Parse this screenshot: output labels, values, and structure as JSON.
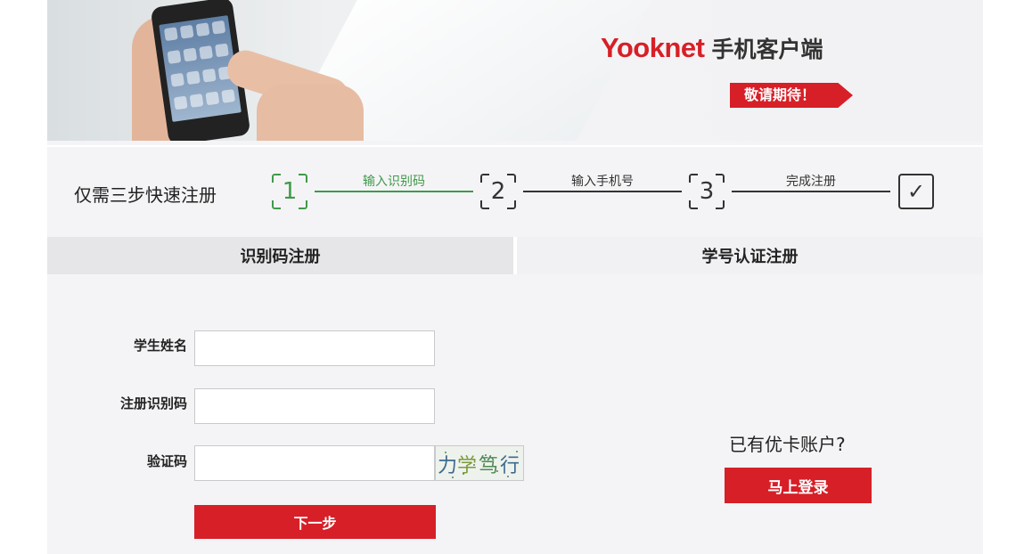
{
  "banner": {
    "brand_logo": "Yooknet",
    "brand_sub": "手机客户端",
    "coming_soon": "敬请期待！"
  },
  "steps": {
    "title": "仅需三步快速注册",
    "items": [
      {
        "number": "1",
        "label": "输入识别码",
        "state": "active"
      },
      {
        "number": "2",
        "label": "输入手机号",
        "state": "pending"
      },
      {
        "number": "3",
        "label": "完成注册",
        "state": "pending"
      }
    ],
    "done_mark": "✓"
  },
  "tabs": [
    {
      "label": "识别码注册",
      "active": true
    },
    {
      "label": "学号认证注册",
      "active": false
    }
  ],
  "form": {
    "student_name_label": "学生姓名",
    "student_name_value": "",
    "reg_code_label": "注册识别码",
    "reg_code_value": "",
    "captcha_label": "验证码",
    "captcha_value": "",
    "captcha_chars": [
      "力",
      "学",
      "笃",
      "行"
    ],
    "next_button": "下一步"
  },
  "login_panel": {
    "prompt": "已有优卡账户?",
    "login_button": "马上登录"
  },
  "colors": {
    "brand_red": "#d71f27",
    "step_active_green": "#3f9a4a"
  }
}
